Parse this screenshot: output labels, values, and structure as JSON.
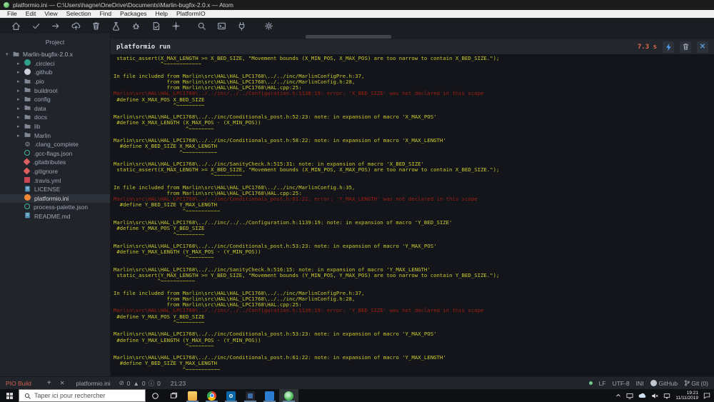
{
  "window": {
    "title": "platformio.ini — C:\\Users\\hagne\\OneDrive\\Documents\\Marlin-bugfix-2.0.x — Atom"
  },
  "menu": {
    "items": [
      "File",
      "Edit",
      "View",
      "Selection",
      "Find",
      "Packages",
      "Help",
      "PlatformIO"
    ]
  },
  "toolbar": {
    "icons": [
      "home",
      "build-check",
      "upload-arrow",
      "remote-upload-cloud",
      "clean-trash",
      "test-flask",
      "debug-bug",
      "remote-dev-file",
      "pipeline",
      "search",
      "terminal",
      "serial-monitor-plug",
      "settings-gear"
    ]
  },
  "sidebar": {
    "header": "Project",
    "root": {
      "label": "Marlin-bugfix-2.0.x",
      "icon": "folder"
    },
    "items": [
      {
        "label": ".circleci",
        "icon": "circleci",
        "chevron": true
      },
      {
        "label": ".github",
        "icon": "github",
        "chevron": true
      },
      {
        "label": ".pio",
        "icon": "folder",
        "chevron": true
      },
      {
        "label": "buildroot",
        "icon": "folder",
        "chevron": true
      },
      {
        "label": "config",
        "icon": "folder",
        "chevron": true
      },
      {
        "label": "data",
        "icon": "folder",
        "chevron": true
      },
      {
        "label": "docs",
        "icon": "folder",
        "chevron": true
      },
      {
        "label": "lib",
        "icon": "folder",
        "chevron": true
      },
      {
        "label": "Marlin",
        "icon": "folder",
        "chevron": true
      },
      {
        "label": ".clang_complete",
        "icon": "gear",
        "chevron": false
      },
      {
        "label": ".gcc-flags.json",
        "icon": "json",
        "chevron": false
      },
      {
        "label": ".gitattributes",
        "icon": "git",
        "chevron": false
      },
      {
        "label": ".gitignore",
        "icon": "git",
        "chevron": false
      },
      {
        "label": ".travis.yml",
        "icon": "travis",
        "chevron": false
      },
      {
        "label": "LICENSE",
        "icon": "book",
        "chevron": false
      },
      {
        "label": "platformio.ini",
        "icon": "platformio",
        "chevron": false,
        "selected": true
      },
      {
        "label": "process-palette.json",
        "icon": "json",
        "chevron": false
      },
      {
        "label": "README.md",
        "icon": "book",
        "chevron": false
      }
    ]
  },
  "terminal": {
    "title": "platformio run",
    "elapsed": "7.3 s",
    "colors": {
      "yellow": "#cbcb2f",
      "red": "#9e2012",
      "background": "#13151a"
    },
    "lines": [
      {
        "c": "y",
        "t": " static_assert(X_MAX_LENGTH >= X_BED_SIZE, \"Movement bounds (X_MIN_POS, X_MAX_POS) are too narrow to contain X_BED_SIZE.\");"
      },
      {
        "c": "y",
        "t": "               ^~~~~~~~~~~~~"
      },
      {
        "c": "y",
        "t": ""
      },
      {
        "c": "y",
        "t": "In file included from Marlin\\src\\HAL\\HAL_LPC1768\\../../inc/MarlinConfigPre.h:37,"
      },
      {
        "c": "y",
        "t": "                 from Marlin\\src\\HAL\\HAL_LPC1768\\../../inc/MarlinConfig.h:28,"
      },
      {
        "c": "y",
        "t": "                 from Marlin\\src\\HAL\\HAL_LPC1768\\HAL.cpp:25:"
      },
      {
        "c": "r",
        "t": "Marlin\\src\\HAL\\HAL_LPC1768\\../../inc/../../Configuration.h:1138:19: error: 'X_BED_SIZE' was not declared in this scope"
      },
      {
        "c": "y",
        "t": " #define X_MAX_POS X_BED_SIZE"
      },
      {
        "c": "y",
        "t": "                   ^~~~~~~~~~"
      },
      {
        "c": "y",
        "t": ""
      },
      {
        "c": "y",
        "t": "Marlin\\src\\HAL\\HAL_LPC1768\\../../inc/Conditionals_post.h:52:23: note: in expansion of macro 'X_MAX_POS'"
      },
      {
        "c": "y",
        "t": " #define X_MAX_LENGTH (X_MAX_POS - (X_MIN_POS))"
      },
      {
        "c": "y",
        "t": "                       ^~~~~~~~~"
      },
      {
        "c": "y",
        "t": ""
      },
      {
        "c": "y",
        "t": "Marlin\\src\\HAL\\HAL_LPC1768\\../../inc/Conditionals_post.h:58:22: note: in expansion of macro 'X_MAX_LENGTH'"
      },
      {
        "c": "y",
        "t": "  #define X_BED_SIZE X_MAX_LENGTH"
      },
      {
        "c": "y",
        "t": "                     ^~~~~~~~~~~~"
      },
      {
        "c": "y",
        "t": ""
      },
      {
        "c": "y",
        "t": "Marlin\\src\\HAL\\HAL_LPC1768\\../../inc/SanityCheck.h:515:31: note: in expansion of macro 'X_BED_SIZE'"
      },
      {
        "c": "y",
        "t": " static_assert(X_MAX_LENGTH >= X_BED_SIZE, \"Movement bounds (X_MIN_POS, X_MAX_POS) are too narrow to contain X_BED_SIZE.\");"
      },
      {
        "c": "y",
        "t": "                               ^~~~~~~~~~"
      },
      {
        "c": "y",
        "t": ""
      },
      {
        "c": "y",
        "t": "In file included from Marlin\\src\\HAL\\HAL_LPC1768\\../../inc/MarlinConfig.h:35,"
      },
      {
        "c": "y",
        "t": "                 from Marlin\\src\\HAL\\HAL_LPC1768\\HAL.cpp:25:"
      },
      {
        "c": "r",
        "t": "Marlin\\src\\HAL\\HAL_LPC1768\\../../inc/Conditionals_post.h:61:22: error: 'Y_MAX_LENGTH' was not declared in this scope"
      },
      {
        "c": "y",
        "t": "  #define Y_BED_SIZE Y_MAX_LENGTH"
      },
      {
        "c": "y",
        "t": "                      ^~~~~~~~~~~~"
      },
      {
        "c": "y",
        "t": ""
      },
      {
        "c": "y",
        "t": "Marlin\\src\\HAL\\HAL_LPC1768\\../../inc/../../Configuration.h:1139:19: note: in expansion of macro 'Y_BED_SIZE'"
      },
      {
        "c": "y",
        "t": " #define Y_MAX_POS Y_BED_SIZE"
      },
      {
        "c": "y",
        "t": "                   ^~~~~~~~~~"
      },
      {
        "c": "y",
        "t": ""
      },
      {
        "c": "y",
        "t": "Marlin\\src\\HAL\\HAL_LPC1768\\../../inc/Conditionals_post.h:53:23: note: in expansion of macro 'Y_MAX_POS'"
      },
      {
        "c": "y",
        "t": " #define Y_MAX_LENGTH (Y_MAX_POS - (Y_MIN_POS))"
      },
      {
        "c": "y",
        "t": "                       ^~~~~~~~~"
      },
      {
        "c": "y",
        "t": ""
      },
      {
        "c": "y",
        "t": "Marlin\\src\\HAL\\HAL_LPC1768\\../../inc/SanityCheck.h:516:15: note: in expansion of macro 'Y_MAX_LENGTH'"
      },
      {
        "c": "y",
        "t": " static_assert(Y_MAX_LENGTH >= Y_BED_SIZE, \"Movement bounds (Y_MIN_POS, Y_MAX_POS) are too narrow to contain Y_BED_SIZE.\");"
      },
      {
        "c": "y",
        "t": "              ^~~~~~~~~~~~"
      },
      {
        "c": "y",
        "t": ""
      },
      {
        "c": "y",
        "t": "In file included from Marlin\\src\\HAL\\HAL_LPC1768\\../../inc/MarlinConfigPre.h:37,"
      },
      {
        "c": "y",
        "t": "                 from Marlin\\src\\HAL\\HAL_LPC1768\\../../inc/MarlinConfig.h:28,"
      },
      {
        "c": "y",
        "t": "                 from Marlin\\src\\HAL\\HAL_LPC1768\\HAL.cpp:25:"
      },
      {
        "c": "r",
        "t": "Marlin\\src\\HAL\\HAL_LPC1768\\../../inc/../../Configuration.h:1139:19: error: 'Y_BED_SIZE' was not declared in this scope"
      },
      {
        "c": "y",
        "t": " #define Y_MAX_POS Y_BED_SIZE"
      },
      {
        "c": "y",
        "t": "                   ^~~~~~~~~~"
      },
      {
        "c": "y",
        "t": ""
      },
      {
        "c": "y",
        "t": "Marlin\\src\\HAL\\HAL_LPC1768\\../../inc/Conditionals_post.h:53:23: note: in expansion of macro 'Y_MAX_POS'"
      },
      {
        "c": "y",
        "t": " #define Y_MAX_LENGTH (Y_MAX_POS - (Y_MIN_POS))"
      },
      {
        "c": "y",
        "t": "                       ^~~~~~~~~"
      },
      {
        "c": "y",
        "t": ""
      },
      {
        "c": "y",
        "t": "Marlin\\src\\HAL\\HAL_LPC1768\\../../inc/Conditionals_post.h:61:22: note: in expansion of macro 'Y_MAX_LENGTH'"
      },
      {
        "c": "y",
        "t": "  #define Y_BED_SIZE Y_MAX_LENGTH"
      },
      {
        "c": "y",
        "t": "                      ^~~~~~~~~~~~"
      }
    ]
  },
  "statusbar": {
    "build_tab": "PIO Build",
    "add_label": "+",
    "close_label": "✕",
    "file": "platformio.ini",
    "error_count": "0",
    "warning_count": "0",
    "info_count": "0",
    "cursor": "21:23",
    "line_ending": "LF",
    "encoding": "UTF-8",
    "grammar": "INI",
    "github_label": "GitHub",
    "git_label": "Git (0)"
  },
  "taskbar": {
    "search_placeholder": "Taper ici pour rechercher",
    "apps": [
      "file-explorer",
      "chrome",
      "outlook",
      "photos",
      "mail",
      "atom"
    ],
    "active_app": "atom",
    "clock_time": "19:21",
    "clock_date": "11/11/2019"
  }
}
